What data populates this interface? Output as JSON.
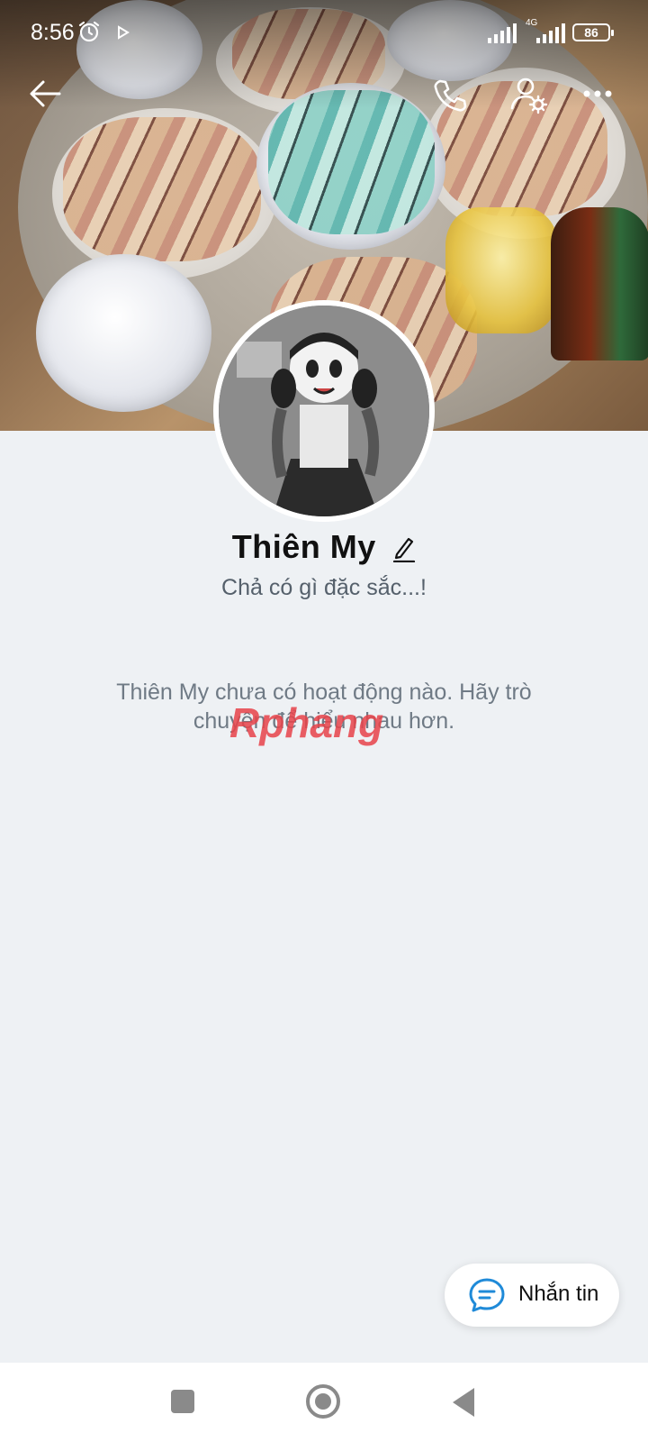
{
  "status_bar": {
    "time": "8:56",
    "network": "4G",
    "battery": "86"
  },
  "profile": {
    "name": "Thiên My",
    "bio": "Chả có gì đặc sắc...!",
    "empty_message": "Thiên My chưa có hoạt động nào. Hãy trò chuyện để hiểu nhau hơn."
  },
  "fab": {
    "label": "Nhắn tin"
  },
  "watermark": {
    "text": "Rphang"
  },
  "icons": {
    "back": "arrow-left-icon",
    "call": "phone-icon",
    "user_settings": "user-gear-icon",
    "more": "more-dots-icon",
    "edit": "pencil-icon",
    "message": "chat-bubble-icon"
  },
  "colors": {
    "background": "#eef1f4",
    "accent": "#1f8ad8",
    "text_primary": "#111111",
    "text_secondary": "#55606b"
  }
}
